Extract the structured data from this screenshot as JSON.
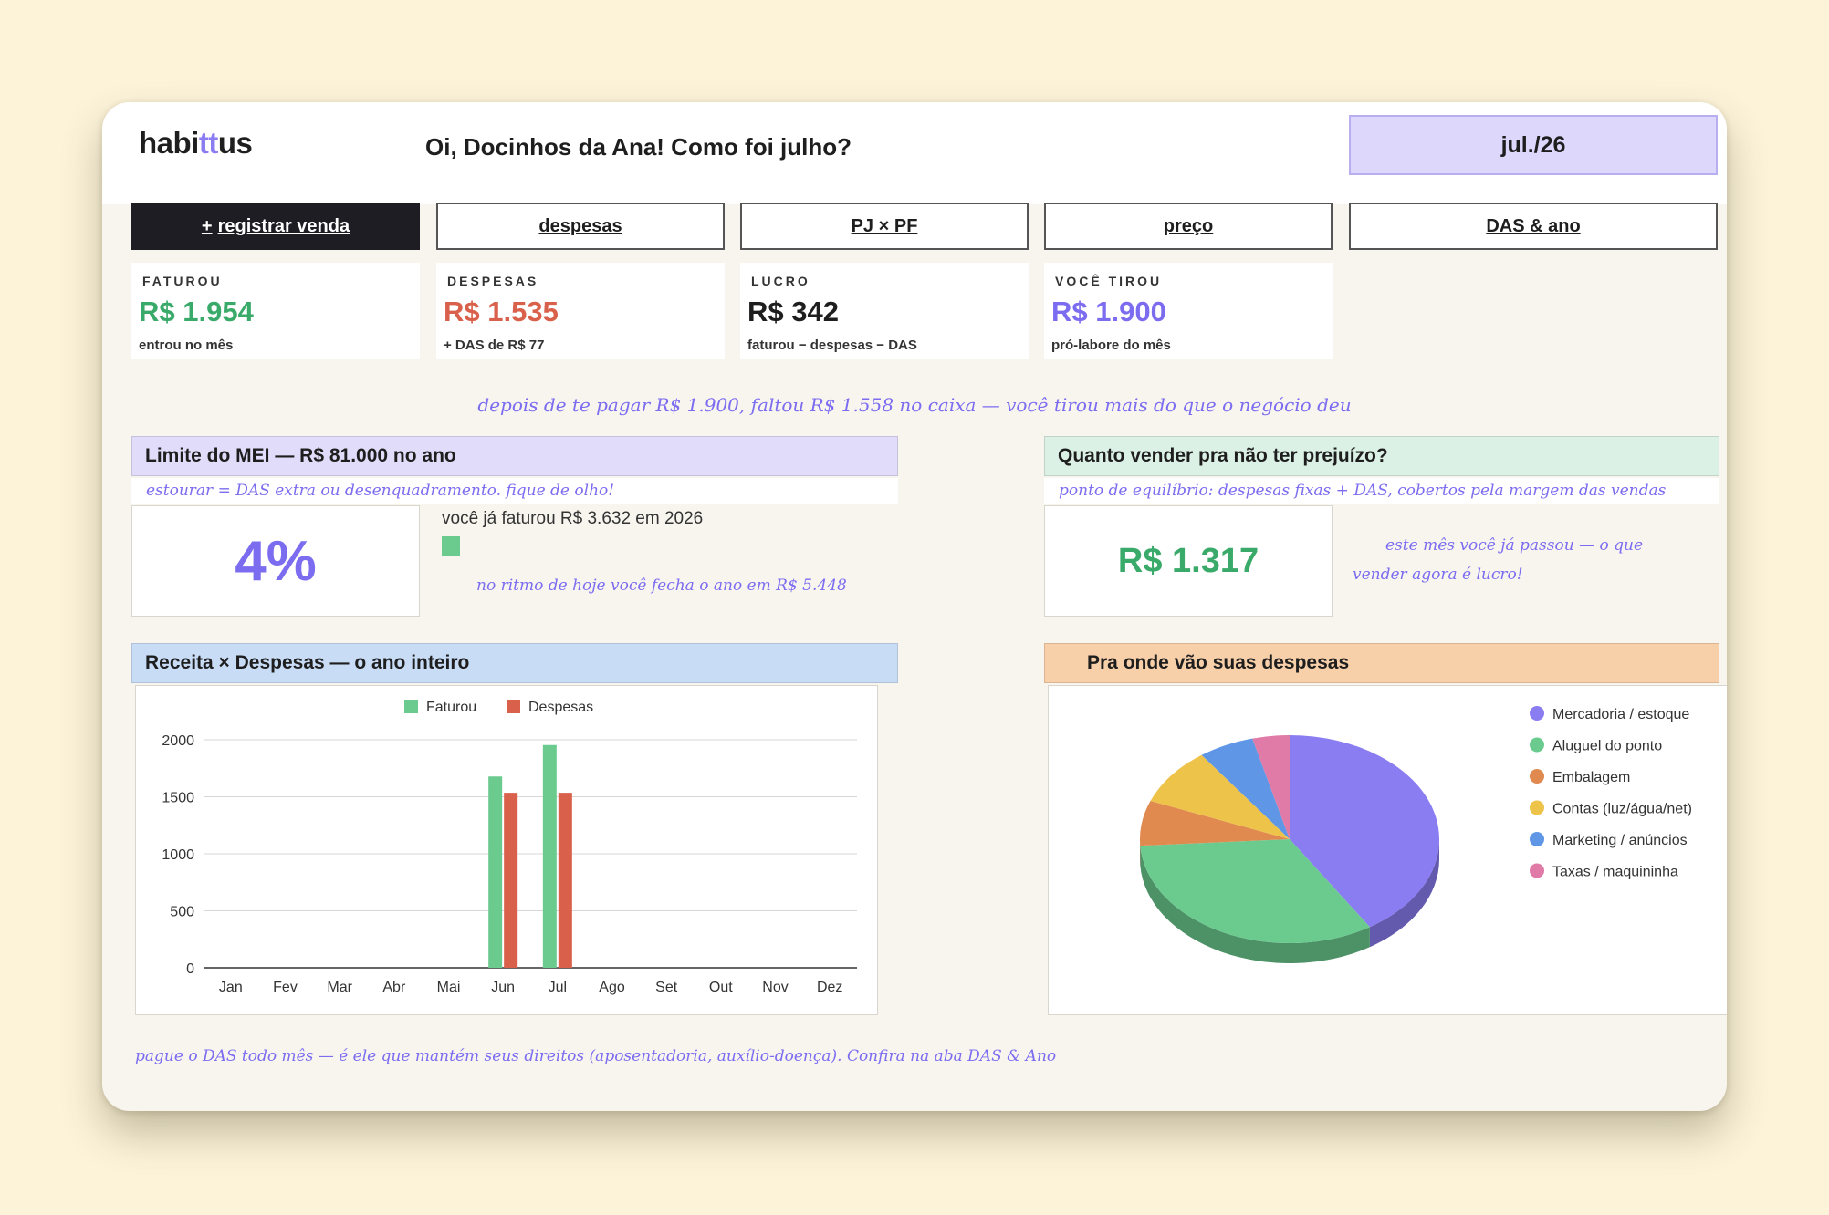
{
  "header": {
    "logo_pre": "habi",
    "logo_mid": "tt",
    "logo_post": "us",
    "greeting": "Oi, Docinhos da Ana! Como foi julho?",
    "month": "jul./26"
  },
  "nav": {
    "register_sale_icon": "+",
    "register_sale": "registrar venda",
    "expenses": "despesas",
    "pj_pf": "PJ × PF",
    "price": "preço",
    "das_year": "DAS & ano"
  },
  "kpis": [
    {
      "label": "FATUROU",
      "value": "R$ 1.954",
      "sub": "entrou no mês",
      "color": "#3aaa6a"
    },
    {
      "label": "DESPESAS",
      "value": "R$ 1.535",
      "sub": "+ DAS de R$ 77",
      "color": "#d9604a"
    },
    {
      "label": "LUCRO",
      "value": "R$ 342",
      "sub": "faturou − despesas − DAS",
      "color": "#1e1e1e"
    },
    {
      "label": "VOCÊ TIROU",
      "value": "R$ 1.900",
      "sub": "pró-labore do mês",
      "color": "#7b6cf0"
    }
  ],
  "alert_note": "depois de te pagar R$ 1.900, faltou R$ 1.558 no caixa — você tirou mais do que o negócio deu",
  "mei": {
    "title": "Limite do MEI — R$ 81.000 no ano",
    "hint": "estourar = DAS extra ou desenquadramento. fique de olho!",
    "percent": "4%",
    "progress": 0.04,
    "billed": "você já faturou R$ 3.632 em 2026",
    "projection": "no ritmo de hoje você fecha o ano em R$ 5.448"
  },
  "breakeven": {
    "title": "Quanto vender pra não ter prejuízo?",
    "hint": "ponto de equilíbrio: despesas fixas + DAS, cobertos pela margem das vendas",
    "value": "R$ 1.317",
    "note": "este mês você já passou — o que vender agora é lucro!"
  },
  "revenue_chart": {
    "title": "Receita × Despesas — o ano inteiro"
  },
  "expenses_chart": {
    "title": "Pra onde vão suas despesas"
  },
  "footnote": "pague o DAS todo mês — é ele que mantém seus direitos (aposentadoria, auxílio-doença). Confira na aba DAS & Ano",
  "colors": {
    "accent": "#7b6cf0",
    "revenue": "#6bcb8f",
    "expenses": "#d9604a",
    "mei_header": "#e1dcf9",
    "breakeven_header": "#dcf1e5",
    "revenue_header": "#c9dcf6",
    "expenses_header": "#f7cfa9"
  },
  "chart_data": [
    {
      "type": "bar",
      "categories": [
        "Jan",
        "Fev",
        "Mar",
        "Abr",
        "Mai",
        "Jun",
        "Jul",
        "Ago",
        "Set",
        "Out",
        "Nov",
        "Dez"
      ],
      "series": [
        {
          "name": "Faturou",
          "values": [
            0,
            0,
            0,
            0,
            0,
            1678,
            1954,
            0,
            0,
            0,
            0,
            0
          ],
          "color": "#6bcb8f"
        },
        {
          "name": "Despesas",
          "values": [
            0,
            0,
            0,
            0,
            0,
            1535,
            1535,
            0,
            0,
            0,
            0,
            0
          ],
          "color": "#d9604a"
        }
      ],
      "yticks": [
        0,
        500,
        1000,
        1500,
        2000
      ],
      "ylim": [
        0,
        2000
      ],
      "grid": true,
      "legend": "top"
    },
    {
      "type": "pie",
      "three_d": true,
      "slices": [
        {
          "label": "Mercadoria / estoque",
          "value": 41,
          "color": "#8a7df2"
        },
        {
          "label": "Aluguel do ponto",
          "value": 33,
          "color": "#6bcb8f"
        },
        {
          "label": "Embalagem",
          "value": 7,
          "color": "#e08a50"
        },
        {
          "label": "Contas (luz/água/net)",
          "value": 9,
          "color": "#edc34a"
        },
        {
          "label": "Marketing / anúncios",
          "value": 6,
          "color": "#5f97e6"
        },
        {
          "label": "Taxas / maquininha",
          "value": 4,
          "color": "#e07aa6"
        }
      ],
      "legend": "right"
    }
  ]
}
